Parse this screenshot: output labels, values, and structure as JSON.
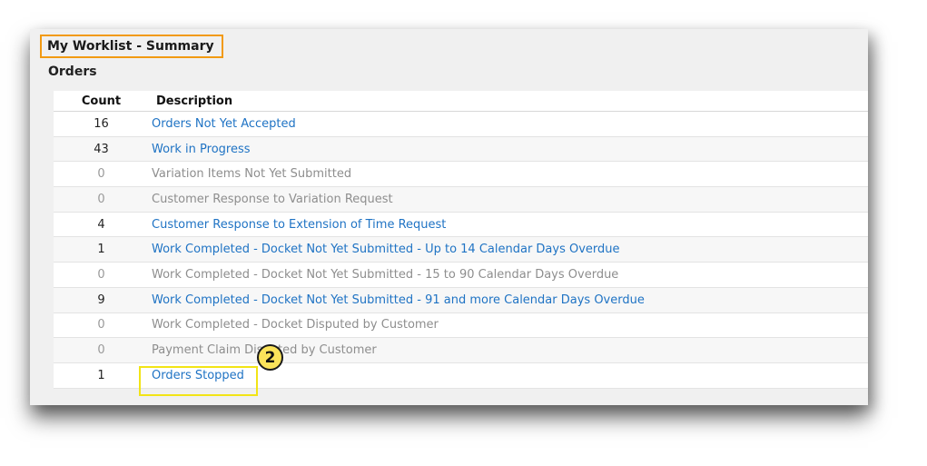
{
  "panel": {
    "title": "My Worklist - Summary",
    "section": "Orders"
  },
  "table": {
    "headers": {
      "count": "Count",
      "description": "Description"
    },
    "rows": [
      {
        "count": "16",
        "description": "Orders Not Yet Accepted"
      },
      {
        "count": "43",
        "description": "Work in Progress"
      },
      {
        "count": "0",
        "description": "Variation Items Not Yet Submitted"
      },
      {
        "count": "0",
        "description": "Customer Response to Variation Request"
      },
      {
        "count": "4",
        "description": "Customer Response to Extension of Time Request"
      },
      {
        "count": "1",
        "description": "Work Completed - Docket Not Yet Submitted - Up to 14 Calendar Days Overdue"
      },
      {
        "count": "0",
        "description": "Work Completed - Docket Not Yet Submitted - 15 to 90 Calendar Days Overdue"
      },
      {
        "count": "9",
        "description": "Work Completed - Docket Not Yet Submitted - 91 and more Calendar Days Overdue"
      },
      {
        "count": "0",
        "description": "Work Completed - Docket Disputed by Customer"
      },
      {
        "count": "0",
        "description": "Payment Claim Disputed by Customer"
      },
      {
        "count": "1",
        "description": "Orders Stopped"
      }
    ]
  },
  "annotation": {
    "step": "2"
  },
  "colors": {
    "link": "#1f73c4",
    "disabled_text": "#8e8e8e",
    "title_highlight": "#f29a12",
    "row_highlight": "#f2e416",
    "badge_fill": "#fbe35a"
  }
}
